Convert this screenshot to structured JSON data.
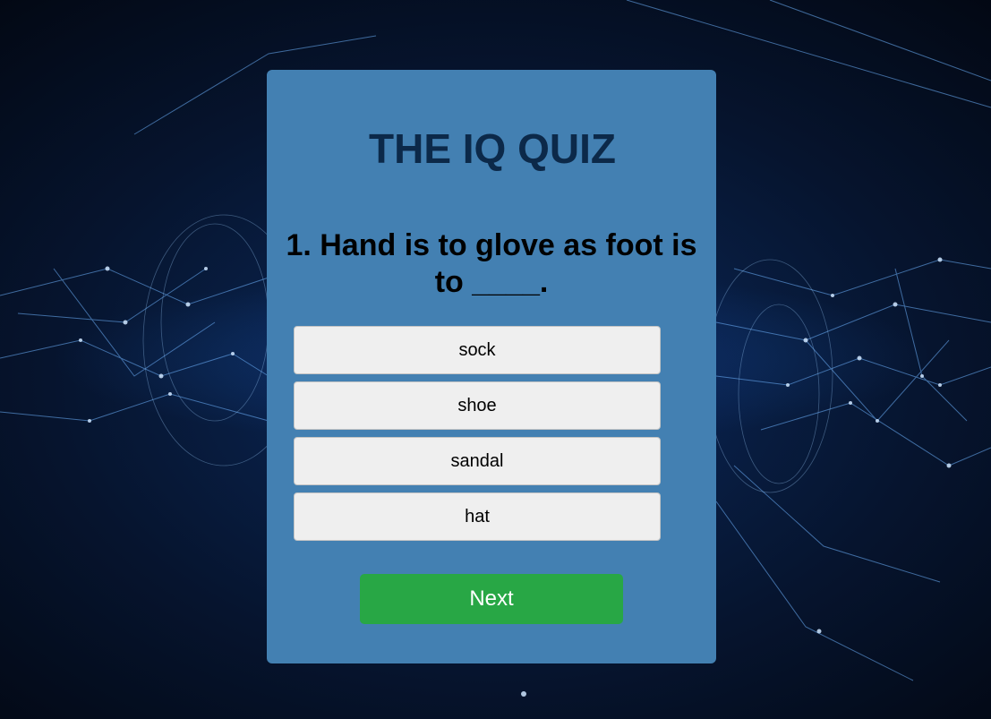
{
  "quiz": {
    "title": "THE IQ QUIZ",
    "question": "1. Hand is to glove as foot is to ____.",
    "answers": [
      {
        "label": "sock"
      },
      {
        "label": "shoe"
      },
      {
        "label": "sandal"
      },
      {
        "label": "hat"
      }
    ],
    "next_label": "Next"
  },
  "colors": {
    "card_background": "#4380b2",
    "title": "#0c2949",
    "answer_background": "#efefef",
    "next_background": "#28a745"
  }
}
